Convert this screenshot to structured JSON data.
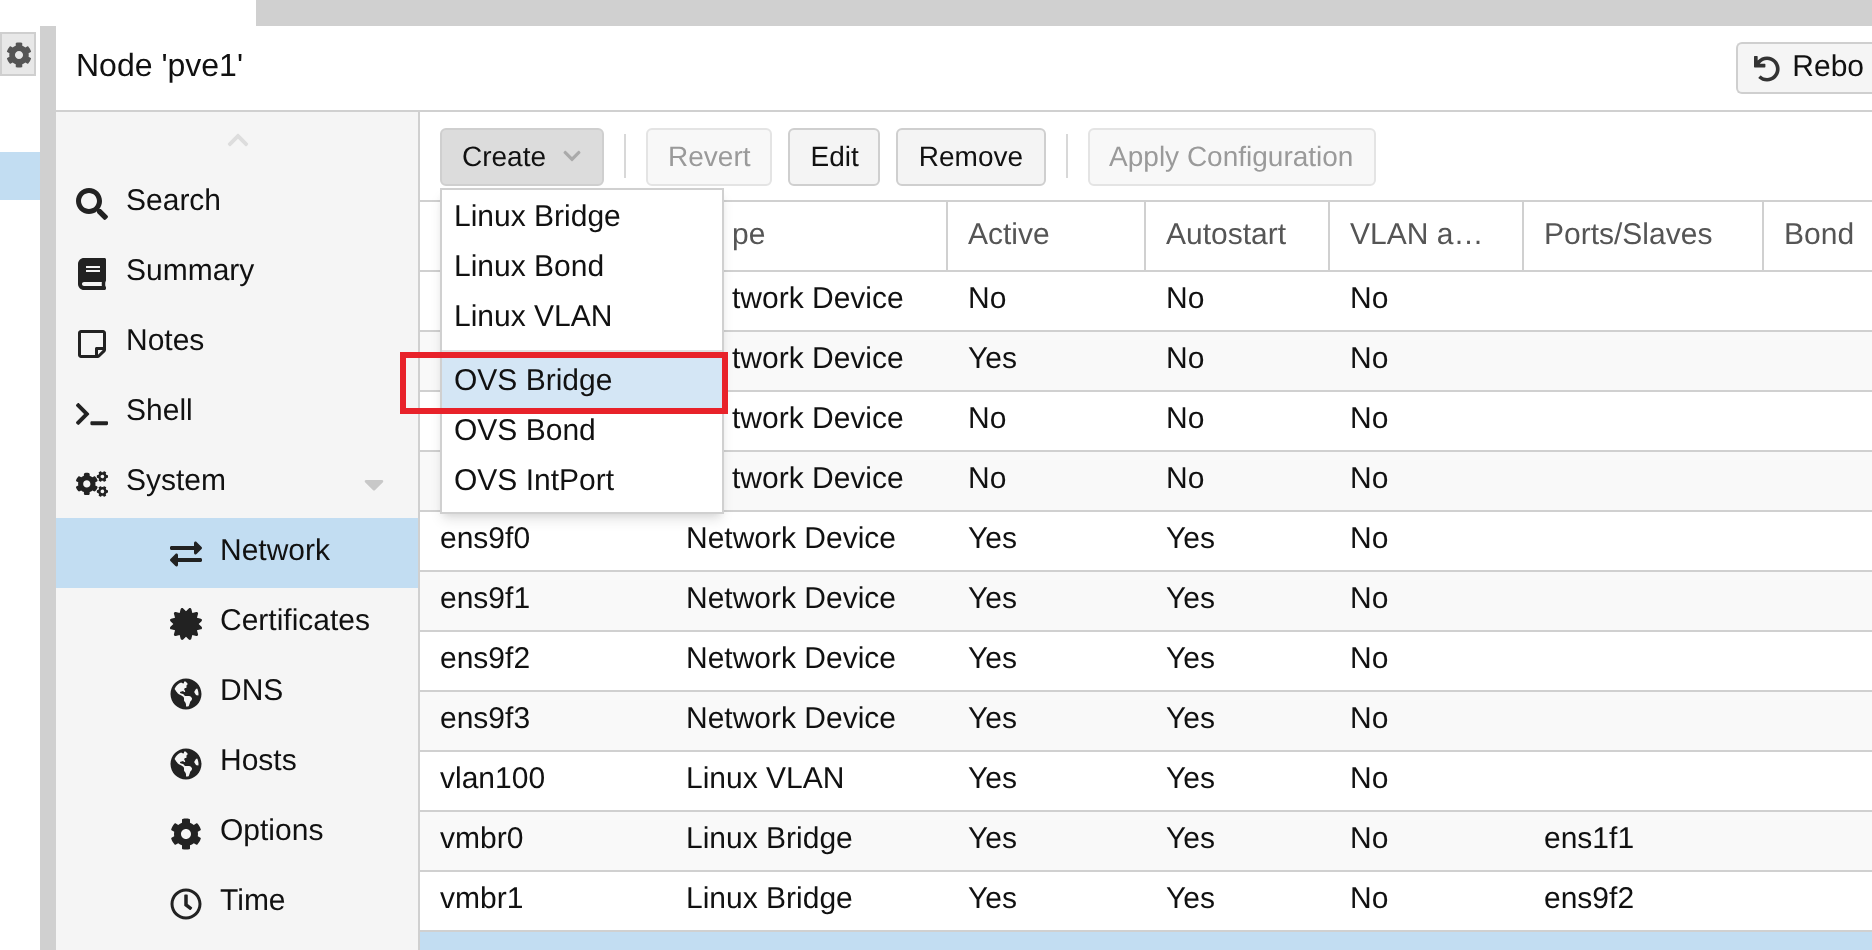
{
  "node_title": "Node 'pve1'",
  "reboot_button": {
    "label": "Rebo"
  },
  "left_strip": {
    "selected_row": true
  },
  "sidebar": {
    "items": [
      {
        "label": "Search",
        "selected": false
      },
      {
        "label": "Summary",
        "selected": false
      },
      {
        "label": "Notes",
        "selected": false
      },
      {
        "label": "Shell",
        "selected": false
      },
      {
        "label": "System",
        "selected": false,
        "expanded": true,
        "children": [
          {
            "label": "Network",
            "selected": true
          },
          {
            "label": "Certificates",
            "selected": false
          },
          {
            "label": "DNS",
            "selected": false
          },
          {
            "label": "Hosts",
            "selected": false
          },
          {
            "label": "Options",
            "selected": false
          },
          {
            "label": "Time",
            "selected": false
          }
        ]
      }
    ]
  },
  "toolbar": [
    {
      "kind": "menu",
      "label": "Create",
      "disabled": false,
      "pressed": true
    },
    {
      "kind": "separator"
    },
    {
      "kind": "button",
      "label": "Revert",
      "disabled": true,
      "pressed": false
    },
    {
      "kind": "button",
      "label": "Edit",
      "disabled": false,
      "pressed": false
    },
    {
      "kind": "button",
      "label": "Remove",
      "disabled": false,
      "pressed": false
    },
    {
      "kind": "separator"
    },
    {
      "kind": "button",
      "label": "Apply Configuration",
      "disabled": true,
      "pressed": false
    }
  ],
  "create_menu": {
    "items": [
      {
        "kind": "item",
        "label": "Linux Bridge",
        "selected": false
      },
      {
        "kind": "item",
        "label": "Linux Bond",
        "selected": false
      },
      {
        "kind": "item",
        "label": "Linux VLAN",
        "selected": false
      },
      {
        "kind": "separator"
      },
      {
        "kind": "item",
        "label": "OVS Bridge",
        "selected": true,
        "highlighted": true
      },
      {
        "kind": "item",
        "label": "OVS Bond",
        "selected": false
      },
      {
        "kind": "item",
        "label": "OVS IntPort",
        "selected": false
      }
    ]
  },
  "table": {
    "columns": [
      {},
      {
        "label": "pe",
        "clipped": true
      },
      {
        "label": "Active"
      },
      {
        "label": "Autostart"
      },
      {
        "label": "VLAN a…"
      },
      {
        "label": "Ports/Slaves"
      },
      {
        "label": "Bond"
      }
    ],
    "rows": [
      {
        "selected": false,
        "clipped": true,
        "cells": [
          null,
          "twork Device",
          "No",
          "No",
          "No",
          null,
          null
        ]
      },
      {
        "selected": false,
        "clipped": true,
        "cells": [
          null,
          "twork Device",
          "Yes",
          "No",
          "No",
          null,
          null
        ]
      },
      {
        "selected": false,
        "clipped": true,
        "cells": [
          null,
          "twork Device",
          "No",
          "No",
          "No",
          null,
          null
        ]
      },
      {
        "selected": false,
        "clipped": true,
        "cells": [
          null,
          "twork Device",
          "No",
          "No",
          "No",
          null,
          null
        ]
      },
      {
        "selected": false,
        "cells": [
          "ens9f0",
          "Network Device",
          "Yes",
          "Yes",
          "No",
          null,
          null
        ]
      },
      {
        "selected": false,
        "cells": [
          "ens9f1",
          "Network Device",
          "Yes",
          "Yes",
          "No",
          null,
          null
        ]
      },
      {
        "selected": false,
        "cells": [
          "ens9f2",
          "Network Device",
          "Yes",
          "Yes",
          "No",
          null,
          null
        ]
      },
      {
        "selected": false,
        "cells": [
          "ens9f3",
          "Network Device",
          "Yes",
          "Yes",
          "No",
          null,
          null
        ]
      },
      {
        "selected": false,
        "cells": [
          "vlan100",
          "Linux VLAN",
          "Yes",
          "Yes",
          "No",
          null,
          null
        ]
      },
      {
        "selected": false,
        "cells": [
          "vmbr0",
          "Linux Bridge",
          "Yes",
          "Yes",
          "No",
          "ens1f1",
          null
        ]
      },
      {
        "selected": false,
        "cells": [
          "vmbr1",
          "Linux Bridge",
          "Yes",
          "Yes",
          "No",
          "ens9f2",
          null
        ]
      },
      {
        "selected": true,
        "cells": [
          null,
          null,
          null,
          null,
          null,
          null,
          null
        ]
      }
    ]
  }
}
